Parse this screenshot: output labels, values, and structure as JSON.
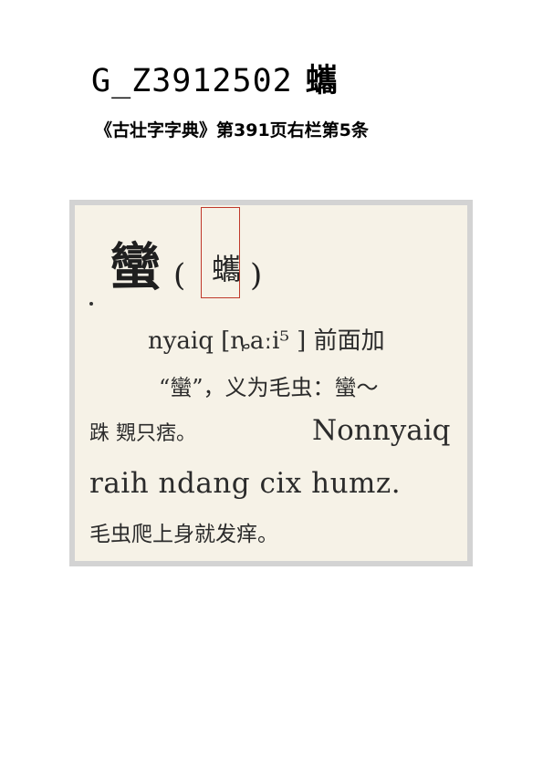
{
  "title": {
    "code": "G_Z3912502",
    "char": "蠵"
  },
  "source": "《古壮字字典》第391页右栏第5条",
  "entry": {
    "head_char": "蠻",
    "paren_open": "(",
    "variant_char": "蠵",
    "paren_close": ")",
    "line1": "nyaiq [ȵaːi⁵ ] 前面加",
    "line2": "“蠻”，义为毛虫：蠻～",
    "line3_cn": "跦 䚉只痞。",
    "line3_en": "Nonnyaiq",
    "line4": "raih ndang cix humz.",
    "line5": "毛虫爬上身就发痒。"
  },
  "colors": {
    "highlight_box": "#c0392b",
    "paper": "#f6f2e7",
    "frame": "#d3d3d3"
  }
}
